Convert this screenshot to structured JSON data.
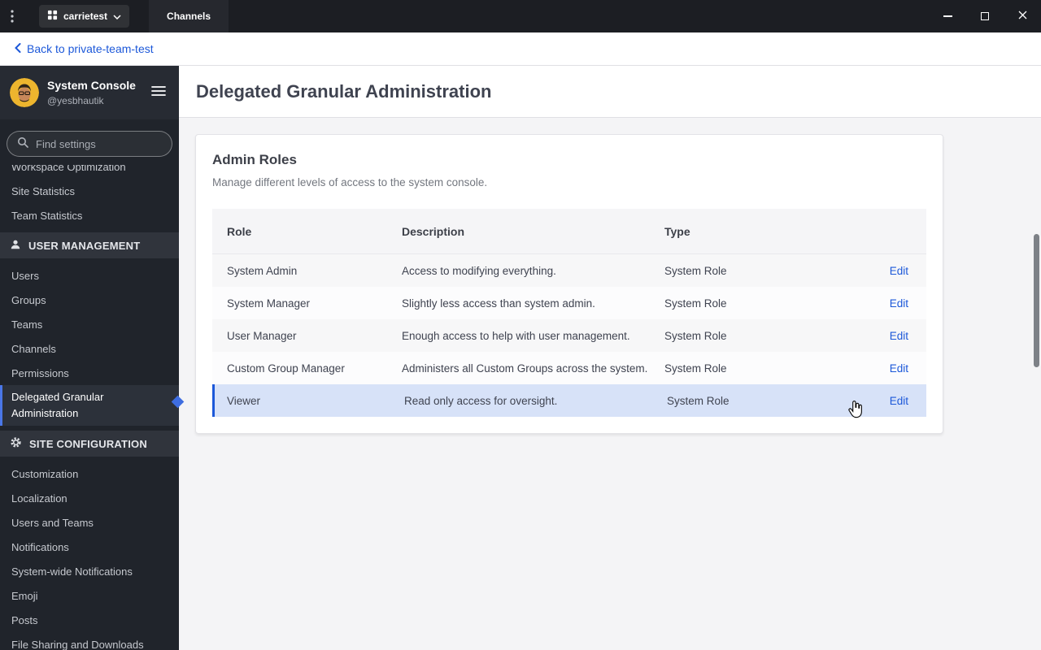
{
  "titlebar": {
    "kebab_icon": "dots-vertical",
    "server_button": {
      "label": "carrietest",
      "icon": "grid",
      "chevron": "chevron-down"
    },
    "tab_label": "Channels",
    "window_controls": [
      "minimize",
      "maximize",
      "close"
    ]
  },
  "backbar": {
    "back_icon": "chevron-left",
    "back_label": "Back to private-team-test"
  },
  "sidebar": {
    "header": {
      "title": "System Console",
      "subtitle": "@yesbhautik",
      "avatar_icon": "user-avatar",
      "menu_icon": "hamburger-menu"
    },
    "search": {
      "icon": "search-magnifier",
      "placeholder": "Find settings"
    },
    "items_top": [
      "Workspace Optimization",
      "Site Statistics",
      "Team Statistics"
    ],
    "sections": [
      {
        "label": "USER MANAGEMENT",
        "icon": "people-icon",
        "items": [
          "Users",
          "Groups",
          "Teams",
          "Channels",
          "Permissions",
          "Delegated Granular Administration"
        ]
      },
      {
        "label": "SITE CONFIGURATION",
        "icon": "gear-icon",
        "items": [
          "Customization",
          "Localization",
          "Users and Teams",
          "Notifications",
          "System-wide Notifications",
          "Emoji",
          "Posts",
          "File Sharing and Downloads"
        ]
      }
    ],
    "active_item": "Delegated Granular Administration"
  },
  "main": {
    "page_title": "Delegated Granular Administration",
    "card": {
      "title": "Admin Roles",
      "subtitle": "Manage different levels of access to the system console.",
      "table": {
        "headers": [
          "Role",
          "Description",
          "Type"
        ],
        "edit_label": "Edit",
        "highlighted_row": "Viewer",
        "rows": [
          {
            "role": "System Admin",
            "description": "Access to modifying everything.",
            "type": "System Role"
          },
          {
            "role": "System Manager",
            "description": "Slightly less access than system admin.",
            "type": "System Role"
          },
          {
            "role": "User Manager",
            "description": "Enough access to help with user management.",
            "type": "System Role"
          },
          {
            "role": "Custom Group Manager",
            "description": "Administers all Custom Groups across the system.",
            "type": "System Role"
          },
          {
            "role": "Viewer",
            "description": "Read only access for oversight.",
            "type": "System Role"
          }
        ]
      }
    }
  },
  "colors": {
    "accent_blue": "#1c58d9",
    "titlebar_bg": "#1c1e23",
    "sidebar_bg": "#20242b",
    "highlight_row_bg": "#d7e2f8",
    "active_item_border": "#4a77e8"
  }
}
